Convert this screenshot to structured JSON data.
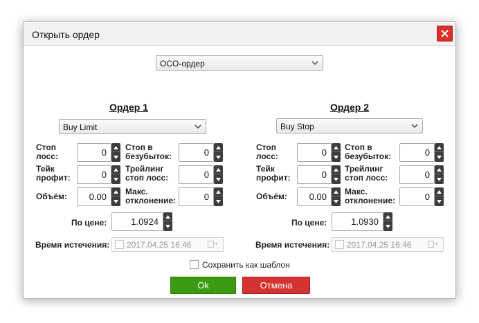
{
  "dialog": {
    "title": "Открыть ордер",
    "close_icon": "close-icon"
  },
  "order_type": {
    "selected": "OCO-ордер"
  },
  "order1": {
    "heading": "Ордер 1",
    "type": "Buy Limit",
    "stop_loss_label": "Стоп лосс:",
    "stop_loss": "0",
    "breakeven_label": "Стоп в безубыток:",
    "breakeven": "0",
    "take_profit_label": "Тейк профит:",
    "take_profit": "0",
    "trailing_label": "Трейлинг стоп лосс:",
    "trailing": "0",
    "volume_label": "Объём:",
    "volume": "0.00",
    "max_dev_label": "Макс. отклонение:",
    "max_dev": "0",
    "price_label": "По цене:",
    "price": "1.0924",
    "expiry_label": "Время истечения:",
    "expiry": "2017.04.25 16:46"
  },
  "order2": {
    "heading": "Ордер 2",
    "type": "Buy Stop",
    "stop_loss_label": "Стоп лосс:",
    "stop_loss": "0",
    "breakeven_label": "Стоп в безубыток:",
    "breakeven": "0",
    "take_profit_label": "Тейк профит:",
    "take_profit": "0",
    "trailing_label": "Трейлинг стоп лосс:",
    "trailing": "0",
    "volume_label": "Объём:",
    "volume": "0.00",
    "max_dev_label": "Макс. отклонение:",
    "max_dev": "0",
    "price_label": "По цене:",
    "price": "1.0930",
    "expiry_label": "Время истечения:",
    "expiry": "2017.04.25 16:46"
  },
  "save_template_label": "Сохранить как шаблон",
  "buttons": {
    "ok": "Ok",
    "cancel": "Отмена"
  },
  "colors": {
    "ok": "#3a9b12",
    "cancel": "#d33432",
    "close": "#d9302c"
  }
}
